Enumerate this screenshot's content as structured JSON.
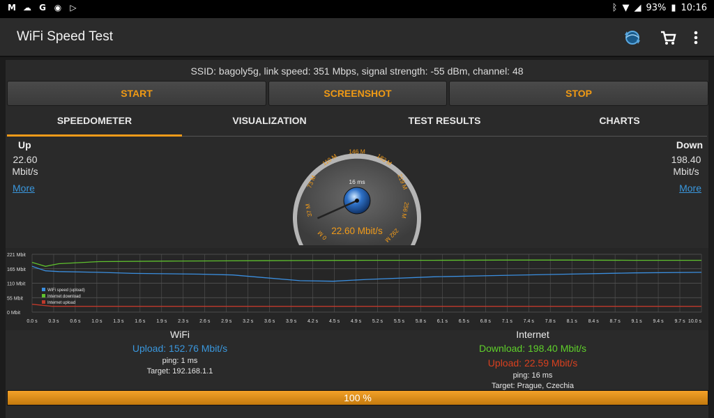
{
  "status_bar": {
    "battery": "93%",
    "time": "10:16",
    "notif_icons": [
      "gmail-icon",
      "cloud-icon",
      "google-icon",
      "circle-icon",
      "play-store-icon"
    ]
  },
  "app": {
    "title": "WiFi Speed Test",
    "icons": [
      "globe-refresh-icon",
      "cart-icon",
      "overflow-menu-icon"
    ]
  },
  "ssid_line": "SSID: bagoly5g, link speed: 351 Mbps, signal strength: -55 dBm, channel: 48",
  "buttons": {
    "start": "START",
    "screenshot": "SCREENSHOT",
    "stop": "STOP"
  },
  "tabs": [
    "SPEEDOMETER",
    "VISUALIZATION",
    "TEST RESULTS",
    "CHARTS"
  ],
  "active_tab": "SPEEDOMETER",
  "up": {
    "label": "Up",
    "value": "22.60",
    "unit": "Mbit/s",
    "more": "More"
  },
  "down": {
    "label": "Down",
    "value": "198.40",
    "unit": "Mbit/s",
    "more": "More"
  },
  "gauge": {
    "ticks": [
      "0 M",
      "37 M",
      "73 M",
      "110 M",
      "146 M",
      "183 M",
      "219 M",
      "256 M",
      "292 M"
    ],
    "ping": "16 ms",
    "reading": "22.60 Mbit/s",
    "value_mbit": 22.6,
    "max_mbit": 292
  },
  "chart_data": {
    "type": "line",
    "y_ticks": [
      "221 Mbit",
      "165 Mbit",
      "110 Mbit",
      "55 Mbit",
      "0 Mbit"
    ],
    "ylim": [
      0,
      221
    ],
    "xlim": [
      0,
      10
    ],
    "x_ticks": [
      "0.0 s",
      "0.3 s",
      "0.6 s",
      "1.0 s",
      "1.3 s",
      "1.6 s",
      "1.9 s",
      "2.3 s",
      "2.6 s",
      "2.9 s",
      "3.2 s",
      "3.6 s",
      "3.9 s",
      "4.2 s",
      "4.5 s",
      "4.9 s",
      "5.2 s",
      "5.5 s",
      "5.8 s",
      "6.1 s",
      "6.5 s",
      "6.8 s",
      "7.1 s",
      "7.4 s",
      "7.8 s",
      "8.1 s",
      "8.4 s",
      "8.7 s",
      "9.1 s",
      "9.4 s",
      "9.7 s",
      "10.0 s"
    ],
    "series": [
      {
        "name": "WiFi speed (upload)",
        "color": "#3b8fe0",
        "x": [
          0,
          0.2,
          0.4,
          1.0,
          1.5,
          2.5,
          3.0,
          4.0,
          4.5,
          5.0,
          6.0,
          7.0,
          8.0,
          9.0,
          10.0
        ],
        "y": [
          175,
          158,
          155,
          152,
          148,
          145,
          142,
          120,
          118,
          125,
          135,
          140,
          145,
          150,
          152
        ]
      },
      {
        "name": "Internet download",
        "color": "#5fc12e",
        "x": [
          0,
          0.2,
          0.4,
          1.0,
          2.0,
          3.0,
          4.0,
          5.0,
          6.0,
          7.0,
          8.0,
          9.0,
          10.0
        ],
        "y": [
          190,
          175,
          185,
          193,
          195,
          196,
          197,
          198,
          198,
          199,
          199,
          198,
          198
        ]
      },
      {
        "name": "Internet upload",
        "color": "#c0392b",
        "x": [
          0,
          0.3,
          1.0,
          2.0,
          3.0,
          4.0,
          5.0,
          6.0,
          7.0,
          8.0,
          9.0,
          10.0
        ],
        "y": [
          30,
          22,
          22,
          22,
          22,
          22,
          22,
          22,
          22,
          22,
          22,
          22
        ]
      }
    ]
  },
  "wifi_stats": {
    "title": "WiFi",
    "upload": "Upload: 152.76 Mbit/s",
    "ping": "ping: 1 ms",
    "target": "Target: 192.168.1.1"
  },
  "internet_stats": {
    "title": "Internet",
    "download": "Download: 198.40 Mbit/s",
    "upload": "Upload: 22.59 Mbit/s",
    "ping": "ping: 16 ms",
    "target": "Target: Prague, Czechia"
  },
  "progress": {
    "label": "100 %",
    "fraction": 1.0
  }
}
